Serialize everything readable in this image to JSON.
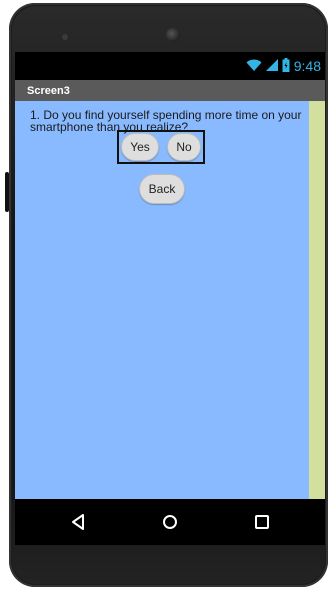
{
  "status_bar": {
    "time": "9:48",
    "icons": [
      "wifi-icon",
      "signal-icon",
      "battery-icon"
    ],
    "accent_color": "#33b5e5"
  },
  "app": {
    "screen_title": "Screen3"
  },
  "content": {
    "question": "1. Do you find yourself spending more time on your smartphone than you realize?",
    "yes_label": "Yes",
    "no_label": "No",
    "back_label": "Back"
  },
  "navigation_bar": {
    "icons": [
      "back-triangle-icon",
      "home-circle-icon",
      "recent-apps-square-icon"
    ]
  },
  "colors": {
    "screen_background": "#89baff",
    "scroll_strip": "#d3e09d",
    "title_bar": "#5a5a5a",
    "button": "#dedede"
  }
}
